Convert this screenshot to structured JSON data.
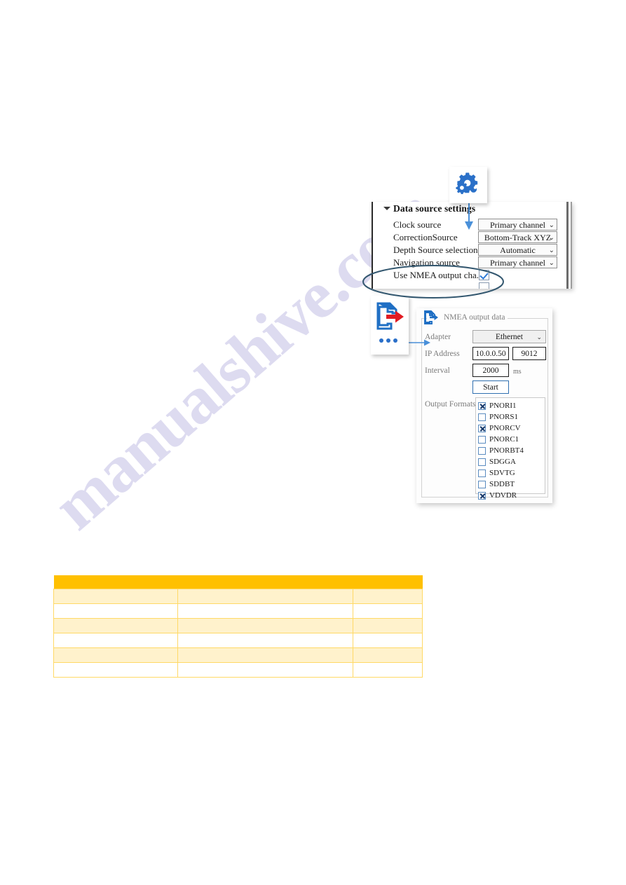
{
  "page": {
    "watermark": "manualshive.com"
  },
  "gear_icon": {
    "name": "settings-gears-icon"
  },
  "data_source_panel": {
    "header": "Data source settings",
    "rows": [
      {
        "label": "Clock source",
        "control": "combo",
        "value": "Primary channel"
      },
      {
        "label": "CorrectionSource",
        "control": "combo",
        "value": "Bottom-Track XYZ"
      },
      {
        "label": "Depth Source selection",
        "control": "combo",
        "value": "Automatic"
      },
      {
        "label": "Navigation source",
        "control": "combo",
        "value": "Primary channel"
      },
      {
        "label": "Use NMEA output cha...",
        "control": "checkbox",
        "value": "",
        "checked": true
      },
      {
        "label": "",
        "control": "checkbox",
        "value": "",
        "checked": false
      }
    ]
  },
  "export_icon": {
    "name": "document-export-icon",
    "dots": "..."
  },
  "nmea_panel": {
    "title": "NMEA output data",
    "adapter_label": "Adapter",
    "adapter_value": "Ethernet",
    "ip_label": "IP Address",
    "ip_value": "10.0.0.50",
    "port_value": "9012",
    "interval_label": "Interval",
    "interval_value": "2000",
    "interval_unit": "ms",
    "start_label": "Start",
    "output_formats_label": "Output Formats",
    "formats": [
      {
        "label": "PNORI1",
        "checked": true
      },
      {
        "label": "PNORS1",
        "checked": false
      },
      {
        "label": "PNORCV",
        "checked": true
      },
      {
        "label": "PNORC1",
        "checked": false
      },
      {
        "label": "PNORBT4",
        "checked": false
      },
      {
        "label": "SDGGA",
        "checked": false
      },
      {
        "label": "SDVTG",
        "checked": false
      },
      {
        "label": "SDDBT",
        "checked": false
      },
      {
        "label": "VDVDR",
        "checked": true
      }
    ]
  },
  "table": {
    "headers": [
      "",
      "",
      ""
    ],
    "rows": [
      [
        "",
        "",
        ""
      ],
      [
        "",
        "",
        ""
      ],
      [
        "",
        "",
        ""
      ],
      [
        "",
        "",
        ""
      ],
      [
        "",
        "",
        ""
      ],
      [
        "",
        "",
        ""
      ]
    ]
  },
  "colors": {
    "accent_blue": "#2a6fc9",
    "arrow_red": "#e11b22",
    "table_header": "#ffc000",
    "table_row_alt": "#fff2cc",
    "table_border": "#ffd966",
    "watermark": "#c9c6e8"
  }
}
